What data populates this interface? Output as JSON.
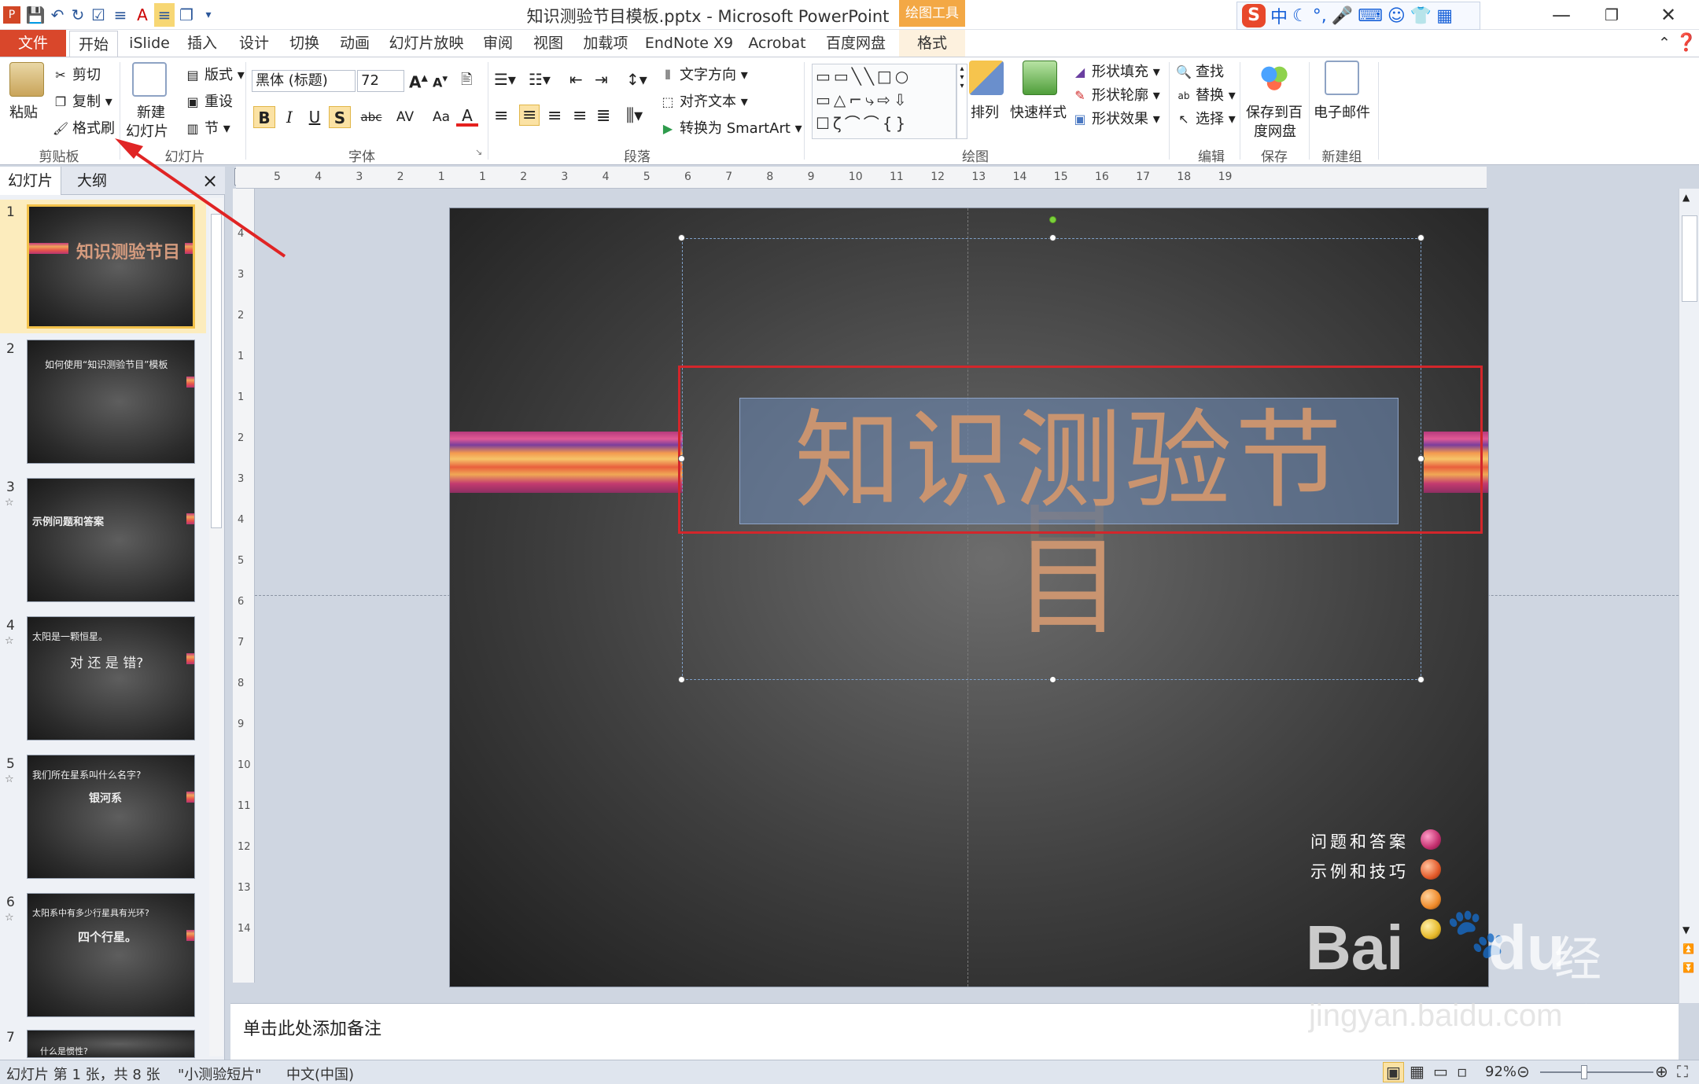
{
  "window": {
    "title": "知识测验节目模板.pptx - Microsoft PowerPoint",
    "context_tab_group": "绘图工具"
  },
  "ime": {
    "lang": "中"
  },
  "tabs": [
    "文件",
    "开始",
    "iSlide",
    "插入",
    "设计",
    "切换",
    "动画",
    "幻灯片放映",
    "审阅",
    "视图",
    "加载项",
    "EndNote X9",
    "Acrobat",
    "百度网盘",
    "格式"
  ],
  "ribbon": {
    "clipboard": {
      "paste": "粘贴",
      "cut": "剪切",
      "copy": "复制",
      "format_painter": "格式刷",
      "label": "剪贴板"
    },
    "slides": {
      "new_slide_1": "新建",
      "new_slide_2": "幻灯片",
      "layout": "版式",
      "reset": "重设",
      "section": "节",
      "label": "幻灯片"
    },
    "font": {
      "name": "黑体 (标题)",
      "size": "72",
      "bold": "B",
      "italic": "I",
      "underline": "U",
      "shadow": "S",
      "strike": "abc",
      "spacing": "AV",
      "case": "Aa",
      "color": "A",
      "label": "字体"
    },
    "paragraph": {
      "text_direction": "文字方向",
      "align_text": "对齐文本",
      "smartart": "转换为 SmartArt",
      "label": "段落"
    },
    "drawing": {
      "arrange": "排列",
      "quick_styles": "快速样式",
      "fill": "形状填充",
      "outline": "形状轮廓",
      "effects": "形状效果",
      "label": "绘图"
    },
    "editing": {
      "find": "查找",
      "replace": "替换",
      "select": "选择",
      "label": "编辑"
    },
    "save": {
      "save_baidu_1": "保存到百",
      "save_baidu_2": "度网盘",
      "label": "保存"
    },
    "newgroup": {
      "email": "电子邮件",
      "label": "新建组"
    }
  },
  "panel": {
    "tab_slides": "幻灯片",
    "tab_outline": "大纲",
    "close": "×"
  },
  "thumbnails": [
    {
      "num": "1",
      "title": "知识测验节目"
    },
    {
      "num": "2",
      "title": "如何使用“知识测验节目”模板"
    },
    {
      "num": "3",
      "title": "示例问题和答案"
    },
    {
      "num": "4",
      "title": "太阳是一颗恒星。",
      "sub": "对 还 是 错?"
    },
    {
      "num": "5",
      "title": "我们所在星系叫什么名字?",
      "sub": "银河系"
    },
    {
      "num": "6",
      "title": "太阳系中有多少行星具有光环?",
      "sub": "四个行星。"
    },
    {
      "num": "7",
      "title": "什么是惯性?"
    }
  ],
  "ruler": {
    "h_ticks": [
      "5",
      "4",
      "3",
      "2",
      "1",
      "1",
      "2",
      "3",
      "4",
      "5",
      "6",
      "7",
      "8",
      "9",
      "10",
      "11",
      "12",
      "13",
      "14",
      "15",
      "16",
      "17",
      "18",
      "19"
    ],
    "v_ticks": [
      "4",
      "3",
      "2",
      "1",
      "1",
      "2",
      "3",
      "4",
      "5",
      "6",
      "7",
      "8",
      "9",
      "10",
      "11",
      "12",
      "13",
      "14"
    ]
  },
  "slide": {
    "title": "知识测验节目",
    "legend": [
      "问题和答案",
      "示例和技巧"
    ]
  },
  "notes": {
    "placeholder": "单击此处添加备注"
  },
  "status": {
    "slide_info": "幻灯片 第 1 张，共 8 张",
    "theme": "\"小测验短片\"",
    "lang": "中文(中国)",
    "zoom": "92%"
  },
  "watermark": {
    "brand": "Bai",
    "brand2": "du",
    "brand3": "经验",
    "url": "jingyan.baidu.com"
  },
  "colors": {
    "file_tab": "#d9472b",
    "accent": "#2b579a",
    "annotation_red": "#d3262b",
    "context_tab": "#f3a845"
  }
}
